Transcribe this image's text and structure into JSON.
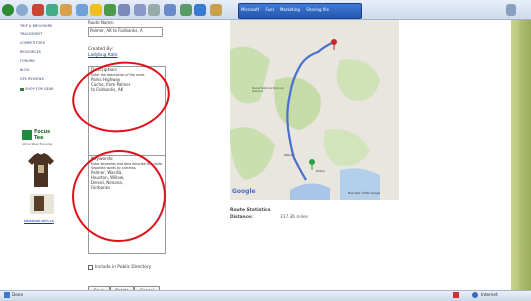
{
  "toolbar": {
    "links": [
      "Microsoft",
      "Fuel",
      "Marketing",
      "Sharing file"
    ]
  },
  "sidebar": {
    "items": [
      "TRIP & BROCHURE",
      "TRACKSHEET",
      "COMPETITORS",
      "RESOURCES",
      "FORUMS",
      "BLOG",
      "GPS REVIEWS",
      "SHOP FOR GEAR"
    ]
  },
  "ad": {
    "logo_line1": "Focus",
    "logo_line2": "Tee",
    "tagline": "Active Wear Everyday",
    "link": "takealook.with.ca"
  },
  "form": {
    "route_name_label": "Route Name:",
    "route_name_value": "Palmer, AK to Fairbanks, A",
    "created_by_label": "Created By:",
    "created_by_value": "Ladybug Kate",
    "description_label": "Description:",
    "description_hint": "Enter the description of the route.",
    "description_text": "Parks Highway Cache, from Palmer to Fairbanks, AK",
    "keywords_label": "Keywords:",
    "keywords_hint": "Enter keywords that best describe this route. Separate words by commas.",
    "keywords_text": "Palmer, Wasilla, Houston, Willow, Denali, Nenana, Fairbanks",
    "public_checkbox_label": "Include in Public Directory",
    "buttons": [
      "Save",
      "Delete",
      "Cancel"
    ]
  },
  "map": {
    "labels": [
      "Denali National Park and Preserve",
      "Wasilla",
      "Palmer"
    ],
    "google_logo": "Google",
    "copyright": "Map data ©2010 Google"
  },
  "stats": {
    "title": "Route Statistics",
    "distance_label": "Distance:",
    "distance_value": "317.36 miles"
  },
  "status": {
    "left": "Done",
    "right": "Internet"
  },
  "colors": {
    "annotation_circle": "#e0101a",
    "route_line": "#4a6fd0"
  }
}
